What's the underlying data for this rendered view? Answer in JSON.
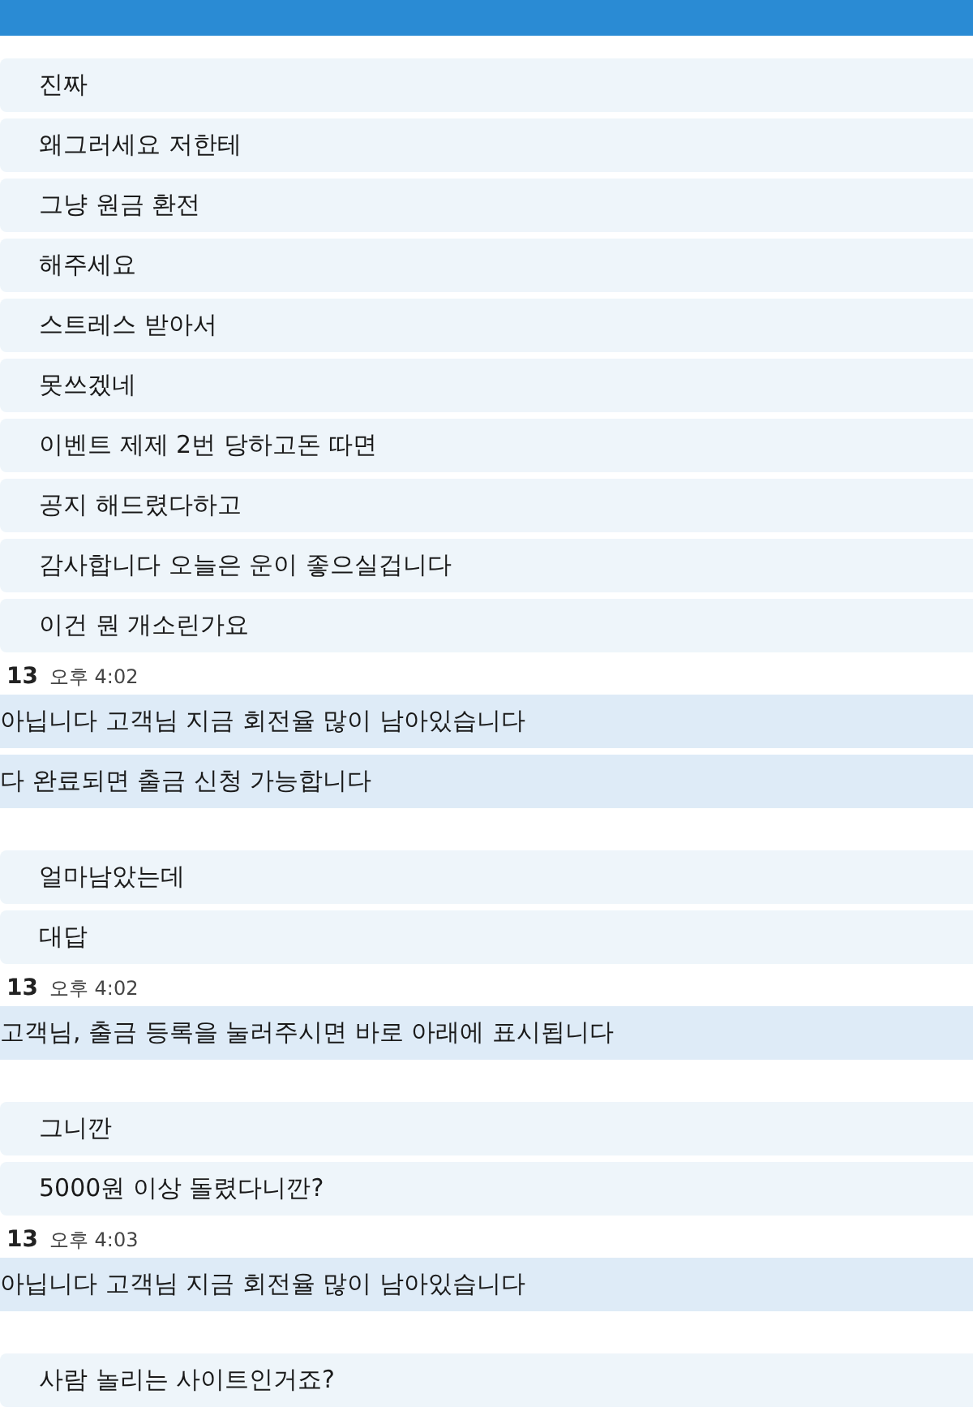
{
  "groups": [
    {
      "kind": "user",
      "lines": [
        "진짜",
        "왜그러세요 저한테",
        "그냥 원금 환전",
        "해주세요",
        "스트레스 받아서",
        "못쓰겠네",
        "이벤트 제제 2번 당하고돈 따면",
        "공지 해드렸다하고",
        "감사합니다 오늘은 운이 좋으실겁니다",
        "이건 뭔 개소린가요"
      ]
    },
    {
      "kind": "agent",
      "sender": "13",
      "time": "오후 4:02",
      "lines": [
        "아닙니다 고객님 지금 회전율 많이 남아있습니다",
        "다 완료되면 출금 신청 가능합니다"
      ]
    },
    {
      "kind": "user",
      "lines": [
        "얼마남았는데",
        "대답"
      ]
    },
    {
      "kind": "agent",
      "sender": "13",
      "time": "오후 4:02",
      "lines": [
        "고객님, 출금 등록을 눌러주시면 바로 아래에 표시됩니다"
      ]
    },
    {
      "kind": "user",
      "lines": [
        "그니깐",
        "5000원 이상 돌렸다니깐?"
      ]
    },
    {
      "kind": "agent",
      "sender": "13",
      "time": "오후 4:03",
      "lines": [
        "아닙니다  고객님 지금 회전율 많이 남아있습니다"
      ]
    },
    {
      "kind": "user",
      "lines": [
        "사람 놀리는 사이트인거죠?"
      ]
    }
  ]
}
